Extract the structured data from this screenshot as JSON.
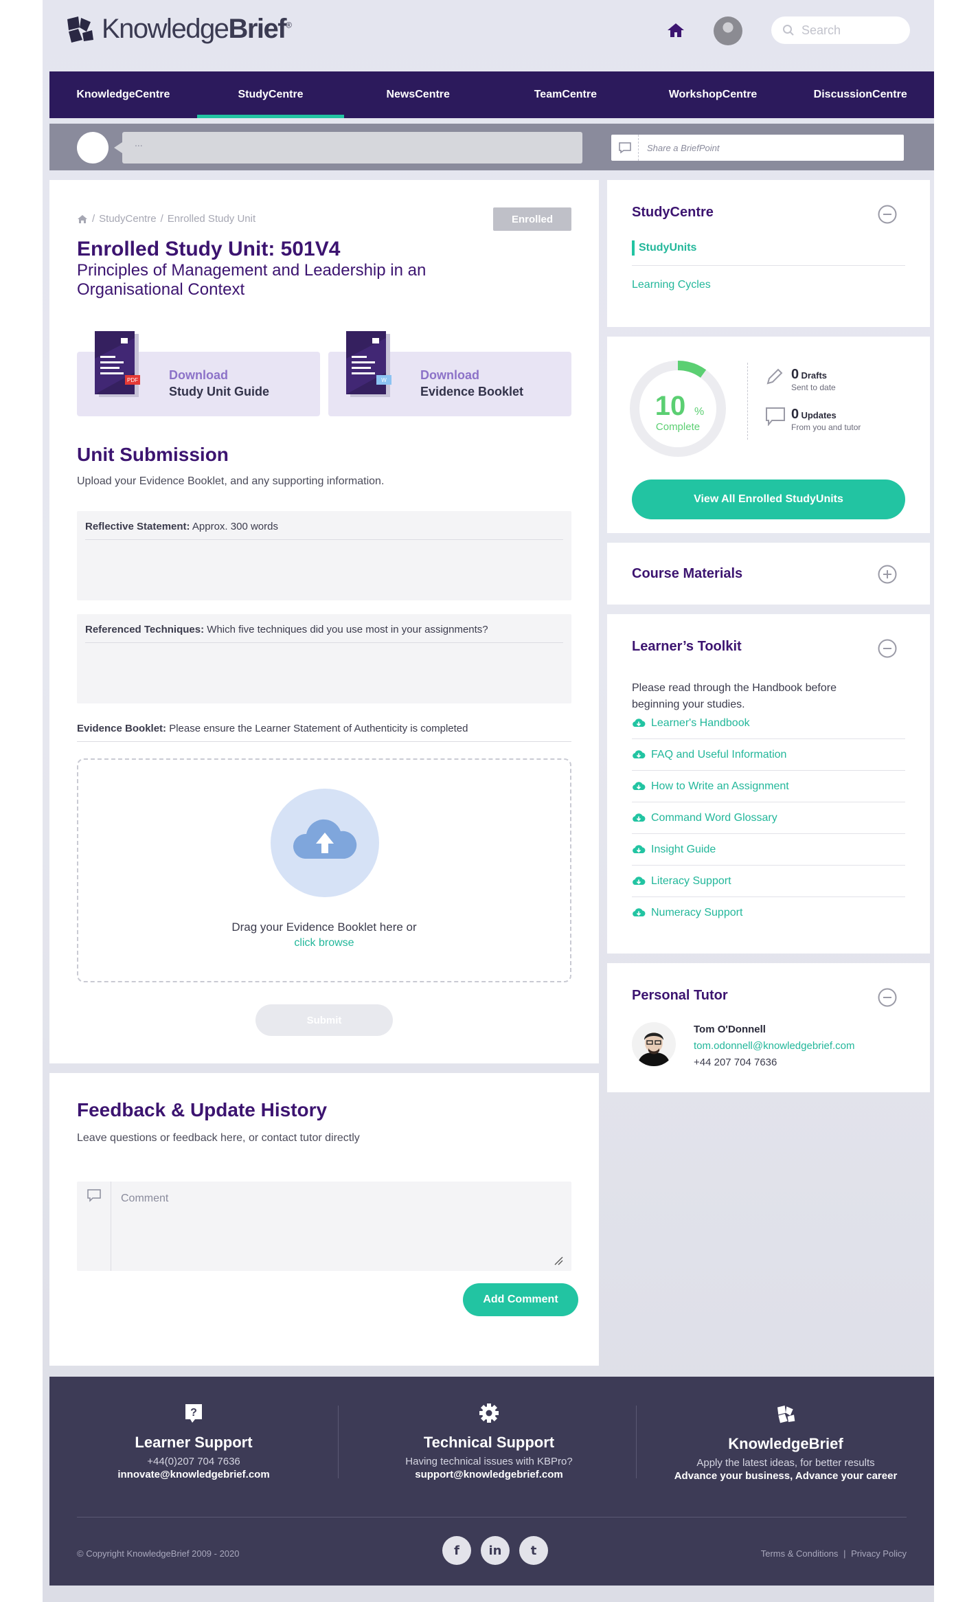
{
  "brand": {
    "logo_light": "Knowledge",
    "logo_bold": "Brief",
    "logo_reg": "®"
  },
  "search": {
    "placeholder": "Search"
  },
  "nav": {
    "items": [
      {
        "label": "KnowledgeCentre"
      },
      {
        "label": "StudyCentre",
        "active": true
      },
      {
        "label": "NewsCentre"
      },
      {
        "label": "TeamCentre"
      },
      {
        "label": "WorkshopCentre"
      },
      {
        "label": "DiscussionCentre"
      }
    ]
  },
  "briefpoint": {
    "bubble_text": "...",
    "share_placeholder": "Share a BriefPoint"
  },
  "breadcrumb": {
    "items": [
      "StudyCentre",
      "Enrolled Study Unit"
    ],
    "separator": "/"
  },
  "unit": {
    "status": "Enrolled",
    "title": "Enrolled Study Unit: 501V4",
    "subtitle": "Principles of Management and Leadership in an Organisational Context"
  },
  "downloads": [
    {
      "action": "Download",
      "name": "Study Unit Guide",
      "file_badge": "PDF"
    },
    {
      "action": "Download",
      "name": "Evidence Booklet",
      "file_badge": "W"
    }
  ],
  "submission": {
    "heading": "Unit Submission",
    "intro": "Upload your Evidence Booklet, and any supporting information.",
    "reflective_label": "Reflective Statement:",
    "reflective_hint": "Approx. 300 words",
    "techniques_label": "Referenced Techniques:",
    "techniques_hint": "Which five techniques did you use most in your assignments?",
    "booklet_label": "Evidence Booklet:",
    "booklet_hint": "Please ensure the Learner Statement of Authenticity is completed",
    "drop_text": "Drag your Evidence Booklet here or",
    "browse_link": "click browse",
    "submit_label": "Submit"
  },
  "feedback": {
    "heading": "Feedback & Update History",
    "intro": "Leave questions or feedback here, or contact tutor directly",
    "comment_placeholder": "Comment",
    "add_label": "Add Comment"
  },
  "studycentre": {
    "title": "StudyCentre",
    "items": [
      "StudyUnits",
      "Learning Cycles"
    ]
  },
  "progress": {
    "percent": 10,
    "percent_sign": "%",
    "complete_label": "Complete",
    "drafts_count": "0",
    "drafts_label": "Drafts",
    "drafts_sub": "Sent to date",
    "updates_count": "0",
    "updates_label": "Updates",
    "updates_sub": "From you and tutor",
    "view_all_label": "View All Enrolled StudyUnits"
  },
  "course_materials": {
    "title": "Course Materials"
  },
  "toolkit": {
    "title": "Learner’s Toolkit",
    "description": "Please read through the Handbook before beginning your studies.",
    "links": [
      "Learner's Handbook",
      "FAQ and Useful Information",
      "How to Write an Assignment",
      "Command Word Glossary",
      "Insight Guide",
      "Literacy Support",
      "Numeracy Support"
    ]
  },
  "tutor": {
    "title": "Personal Tutor",
    "name": "Tom O'Donnell",
    "email": "tom.odonnell@knowledgebrief.com",
    "phone": "+44 207 704 7636"
  },
  "footer": {
    "learner": {
      "title": "Learner Support",
      "line1": "+44(0)207 704 7636",
      "line2": "innovate@knowledgebrief.com"
    },
    "technical": {
      "title": "Technical Support",
      "line1": "Having technical issues with KBPro?",
      "line2": "support@knowledgebrief.com"
    },
    "brand": {
      "title": "KnowledgeBrief",
      "line1": "Apply the latest ideas, for better results",
      "line2": "Advance your business, Advance your career"
    },
    "copyright": "© Copyright KnowledgeBrief 2009 - 2020",
    "social": [
      "f",
      "in",
      "t"
    ],
    "terms": "Terms & Conditions",
    "privacy": "Privacy Policy"
  },
  "colors": {
    "primary": "#3c1470",
    "nav": "#2c1a5c",
    "accent": "#22c4a2",
    "footer": "#3d3b56"
  }
}
